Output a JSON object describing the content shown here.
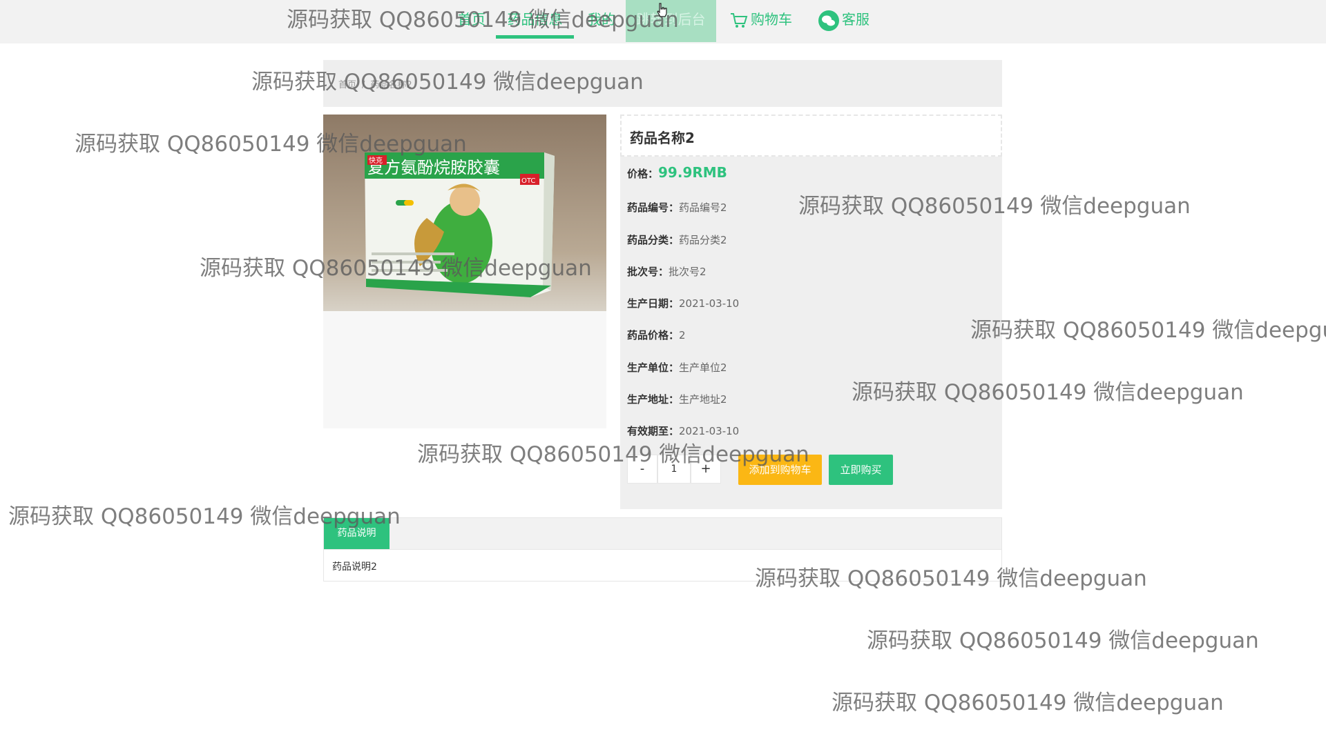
{
  "nav": {
    "items": [
      {
        "label": "首页"
      },
      {
        "label": "药品信息"
      },
      {
        "label": "我的"
      },
      {
        "label": "跳转到后台"
      },
      {
        "label": "购物车"
      },
      {
        "label": "客服"
      }
    ]
  },
  "breadcrumb": {
    "home": "首页",
    "separator": "/",
    "current": "药品名称2"
  },
  "product": {
    "name": "药品名称2",
    "price_label": "价格：",
    "price_value": "99.9RMB",
    "fields": [
      {
        "label": "药品编号：",
        "value": "药品编号2"
      },
      {
        "label": "药品分类：",
        "value": "药品分类2"
      },
      {
        "label": "批次号：",
        "value": "批次号2"
      },
      {
        "label": "生产日期：",
        "value": "2021-03-10"
      },
      {
        "label": "药品价格：",
        "value": "2"
      },
      {
        "label": "生产单位：",
        "value": "生产单位2"
      },
      {
        "label": "生产地址：",
        "value": "生产地址2"
      },
      {
        "label": "有效期至：",
        "value": "2021-03-10"
      }
    ],
    "image": {
      "box_text": "复方氨酚烷胺胶囊",
      "badge": "OTC",
      "brand": "快克"
    }
  },
  "purchase": {
    "minus": "-",
    "quantity": "1",
    "plus": "+",
    "add_to_cart": "添加到购物车",
    "buy_now": "立即购买"
  },
  "description": {
    "tab": "药品说明",
    "body": "药品说明2"
  },
  "watermark": {
    "text": "源码获取 QQ86050149 微信deepguan"
  },
  "colors": {
    "accent": "#2ec27e",
    "cart_button": "#fbb714"
  }
}
